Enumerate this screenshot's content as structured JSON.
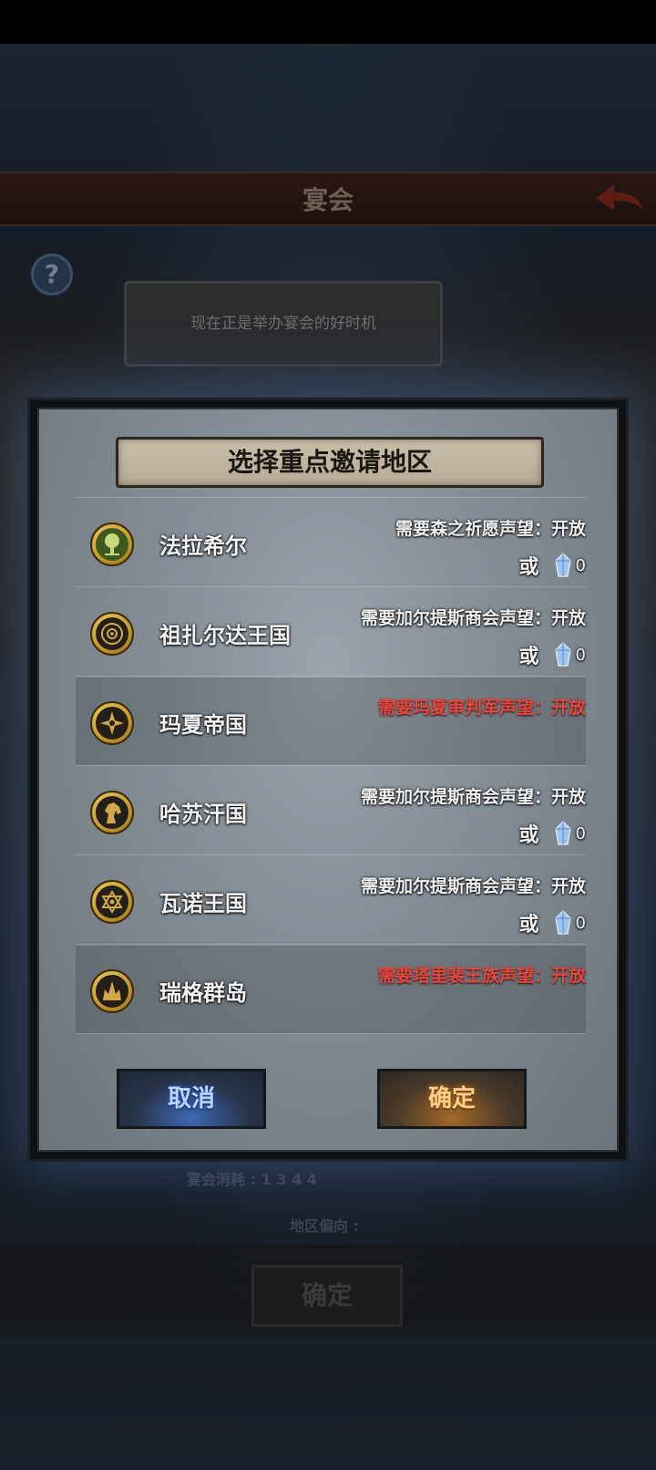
{
  "background": {
    "screen_title": "宴会",
    "help_label": "?",
    "speech_bubble": "现在正是举办宴会的好时机",
    "cost_line": "宴会消耗 : 1 3 4 4",
    "region_bias_label": "地区偏向 :",
    "confirm_label": "确定",
    "back_icon": "back-arrow-icon"
  },
  "dialog": {
    "title": "选择重点邀请地区",
    "or_label": "或",
    "gem_icon": "crystal-gem-icon",
    "rows": [
      {
        "name": "法拉希尔",
        "emblem": "tree-emblem-icon",
        "requirement": "需要森之祈愿声望：开放",
        "locked": false,
        "cost": "0"
      },
      {
        "name": "祖扎尔达王国",
        "emblem": "sun-swirl-emblem-icon",
        "requirement": "需要加尔提斯商会声望：开放",
        "locked": false,
        "cost": "0"
      },
      {
        "name": "玛夏帝国",
        "emblem": "compass-star-emblem-icon",
        "requirement": "需要玛夏审判军声望：开放",
        "locked": true,
        "cost": ""
      },
      {
        "name": "哈苏汗国",
        "emblem": "horse-head-emblem-icon",
        "requirement": "需要加尔提斯商会声望：开放",
        "locked": false,
        "cost": "0"
      },
      {
        "name": "瓦诺王国",
        "emblem": "hexagram-emblem-icon",
        "requirement": "需要加尔提斯商会声望：开放",
        "locked": false,
        "cost": "0"
      },
      {
        "name": "瑞格群岛",
        "emblem": "crown-spire-emblem-icon",
        "requirement": "需要塔里裴王族声望：开放",
        "locked": true,
        "cost": ""
      }
    ],
    "cancel_label": "取消",
    "confirm_label": "确定"
  },
  "colors": {
    "locked_requirement": "#e14a3e",
    "cancel_glow": "#3e6ab6",
    "confirm_glow": "#a36a2a"
  }
}
